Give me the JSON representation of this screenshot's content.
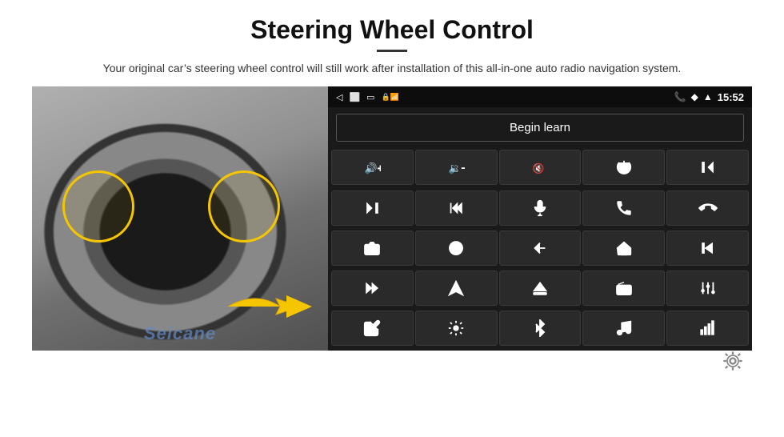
{
  "header": {
    "title": "Steering Wheel Control",
    "subtitle": "Your original car’s steering wheel control will still work after installation of this all-in-one auto radio navigation system."
  },
  "android_ui": {
    "status_bar": {
      "time": "15:52",
      "back_icon": "◁",
      "home_icon": "□",
      "recents_icon": "□",
      "notification_icon": "⌂",
      "signal_icon": "♥",
      "wifi_icon": "▲",
      "phone_icon": "✆"
    },
    "begin_learn_label": "Begin learn",
    "buttons": [
      {
        "icon": "vol-up",
        "title": "Volume Up"
      },
      {
        "icon": "vol-down",
        "title": "Volume Down"
      },
      {
        "icon": "vol-mute",
        "title": "Mute"
      },
      {
        "icon": "power",
        "title": "Power"
      },
      {
        "icon": "prev-track",
        "title": "Previous Track"
      },
      {
        "icon": "next-track",
        "title": "Next Track"
      },
      {
        "icon": "prev-seek",
        "title": "Prev Seek"
      },
      {
        "icon": "mic",
        "title": "Microphone"
      },
      {
        "icon": "phone",
        "title": "Phone"
      },
      {
        "icon": "hang-up",
        "title": "Hang Up"
      },
      {
        "icon": "camera",
        "title": "Camera"
      },
      {
        "icon": "360-view",
        "title": "360 View"
      },
      {
        "icon": "back",
        "title": "Back"
      },
      {
        "icon": "home",
        "title": "Home"
      },
      {
        "icon": "skip-prev",
        "title": "Skip Previous"
      },
      {
        "icon": "fast-forward",
        "title": "Fast Forward"
      },
      {
        "icon": "navigate",
        "title": "Navigate"
      },
      {
        "icon": "eject",
        "title": "Eject"
      },
      {
        "icon": "radio",
        "title": "Radio"
      },
      {
        "icon": "equalizer",
        "title": "Equalizer"
      },
      {
        "icon": "pen",
        "title": "Pen"
      },
      {
        "icon": "settings2",
        "title": "Settings"
      },
      {
        "icon": "bluetooth",
        "title": "Bluetooth"
      },
      {
        "icon": "music",
        "title": "Music"
      },
      {
        "icon": "sound-bars",
        "title": "Sound Bars"
      }
    ]
  },
  "watermark": "Seicane",
  "settings_icon": "gear"
}
